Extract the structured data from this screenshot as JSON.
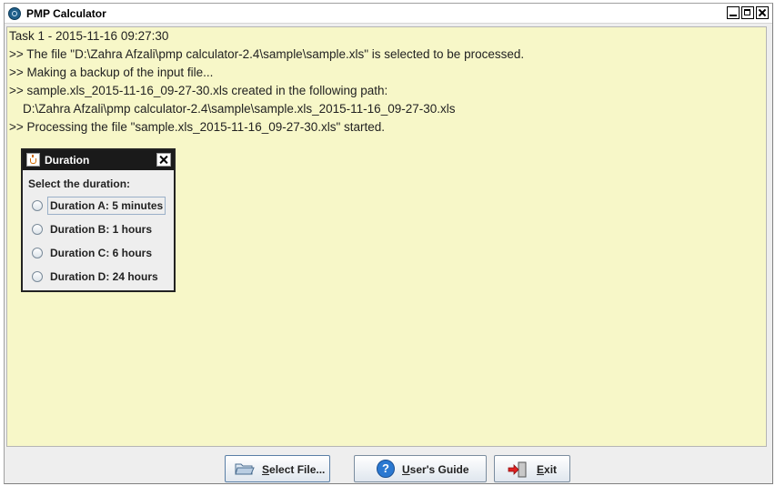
{
  "window": {
    "title": "PMP Calculator"
  },
  "log": {
    "lines": [
      "Task 1 - 2015-11-16 09:27:30",
      ">> The file \"D:\\Zahra Afzali\\pmp calculator-2.4\\sample\\sample.xls\" is selected to be processed.",
      ">> Making a backup of the input file...",
      ">> sample.xls_2015-11-16_09-27-30.xls created in the following path:",
      "    D:\\Zahra Afzali\\pmp calculator-2.4\\sample\\sample.xls_2015-11-16_09-27-30.xls",
      ">> Processing the file \"sample.xls_2015-11-16_09-27-30.xls\" started."
    ]
  },
  "dialog": {
    "title": "Duration",
    "prompt": "Select the duration:",
    "options": [
      {
        "label": "Duration A: 5 minutes",
        "selected": false,
        "focused": true
      },
      {
        "label": "Duration B: 1 hours",
        "selected": false,
        "focused": false
      },
      {
        "label": "Duration C: 6 hours",
        "selected": false,
        "focused": false
      },
      {
        "label": "Duration D: 24 hours",
        "selected": false,
        "focused": false
      }
    ]
  },
  "buttons": {
    "select_file": {
      "mnemonic": "S",
      "rest": "elect File..."
    },
    "users_guide": {
      "mnemonic": "U",
      "rest": "ser's Guide"
    },
    "exit": {
      "mnemonic": "E",
      "rest": "xit"
    }
  },
  "colors": {
    "log_background": "#f7f7c8",
    "dialog_titlebar": "#1a1a1a",
    "help_icon": "#2a78d1",
    "exit_arrow": "#e02020"
  },
  "icons": {
    "app": "app-globe-icon",
    "dialog": "java-cup-icon",
    "select_file": "folder-open-icon",
    "users_guide": "help-question-icon",
    "exit": "exit-door-icon"
  }
}
